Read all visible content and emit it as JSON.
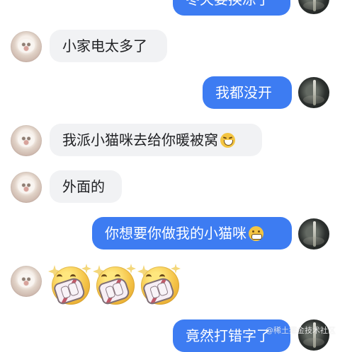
{
  "messages": [
    {
      "id": "m1",
      "side": "right",
      "text": "冬天要换凉了"
    },
    {
      "id": "m2",
      "side": "left",
      "text": "小家电太多了"
    },
    {
      "id": "m3",
      "side": "right",
      "text": "我都没开"
    },
    {
      "id": "m4",
      "side": "left",
      "text": "我派小猫咪去给你暖被窝",
      "emoji": "rolling-laugh-emoji"
    },
    {
      "id": "m5",
      "side": "left",
      "text": "外面的"
    },
    {
      "id": "m6",
      "side": "right",
      "text": "你想要你做我的小猫咪",
      "emoji": "grinning-emoji"
    },
    {
      "id": "m7",
      "side": "left",
      "sticker": "shocked-paws-sticker",
      "count": 3
    },
    {
      "id": "m8",
      "side": "right",
      "text": "竟然打错字了"
    }
  ],
  "watermark": "@稀土掘金技术社区",
  "colors": {
    "self_bubble": "#3d7cf2",
    "other_bubble": "#f1f2f4",
    "background": "#ffffff"
  }
}
